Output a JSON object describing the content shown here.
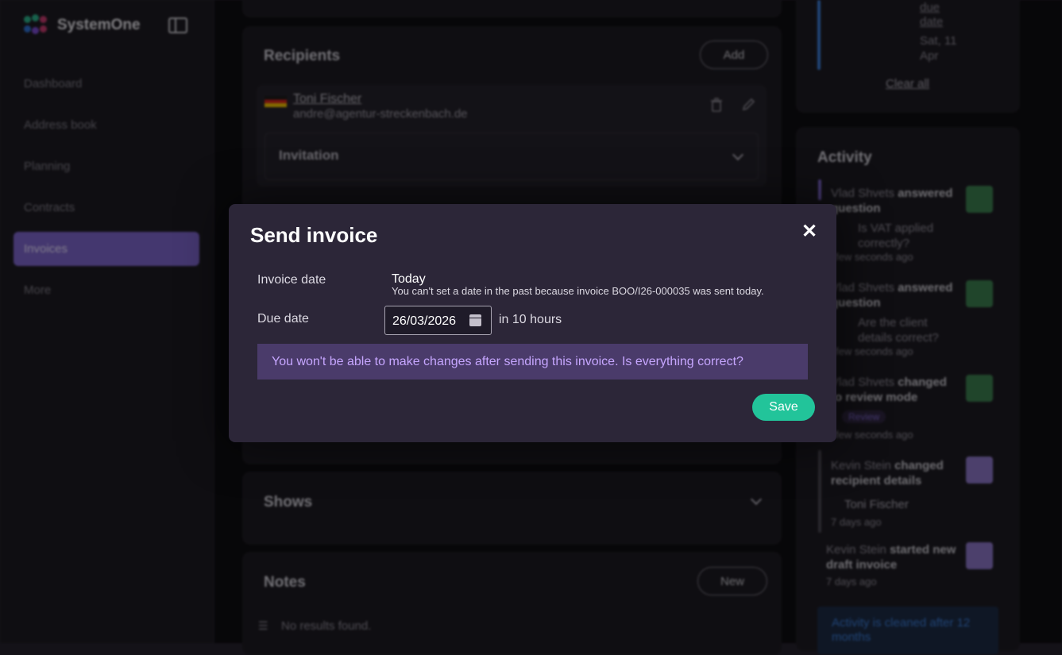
{
  "app": {
    "name": "SystemOne"
  },
  "sidebar": {
    "items": [
      {
        "label": "Dashboard"
      },
      {
        "label": "Address book"
      },
      {
        "label": "Planning"
      },
      {
        "label": "Contracts"
      },
      {
        "label": "Invoices"
      },
      {
        "label": "More"
      }
    ]
  },
  "recipients": {
    "title": "Recipients",
    "add_label": "Add",
    "recipient": {
      "name": "Toni Fischer",
      "email": "andre@agentur-streckenbach.de",
      "section": "Invitation"
    }
  },
  "shows": {
    "title": "Shows"
  },
  "notes": {
    "title": "Notes",
    "new_label": "New",
    "empty": "No results found."
  },
  "filter_panel": {
    "due_link": "due",
    "date_word": "date",
    "date_day": "Sat, 11",
    "date_month": "Apr",
    "clear_all": "Clear all"
  },
  "activity": {
    "title": "Activity",
    "items": [
      {
        "line1_name": "Vlad Shvets",
        "line1_action": "answered",
        "line2": "question",
        "detail1": "Is VAT applied",
        "detail2": "correctly?",
        "time": "few seconds ago"
      },
      {
        "line1_name": "Vlad Shvets",
        "line1_action": "answered",
        "line2": "question",
        "detail1": "Are the client",
        "detail2": "details correct?",
        "time": "few seconds ago"
      },
      {
        "line1_name": "Vlad Shvets",
        "line1_action": "changed",
        "line2": "to review mode",
        "badge": "Review",
        "time": "few seconds ago"
      },
      {
        "line1_name": "Kevin Stein",
        "line1_action": "changed",
        "line2": "recipient details",
        "detail1": "Toni Fischer",
        "time": "7 days ago"
      },
      {
        "line1_name": "Kevin Stein",
        "line1_action": "started new",
        "line2": "draft invoice",
        "time": "7 days ago"
      }
    ],
    "notice_line1": "Activity is cleaned after 12",
    "notice_line2": "months"
  },
  "modal": {
    "title": "Send invoice",
    "invoice_date_label": "Invoice date",
    "invoice_date_value": "Today",
    "invoice_date_warning": "You can't set a date in the past because invoice BOO/I26-000035 was sent today.",
    "due_date_label": "Due date",
    "due_date_value": "26/03/2026",
    "due_relative": "in 10 hours",
    "notice": "You won't be able to make changes after sending this invoice. Is everything correct?",
    "save_label": "Save",
    "close_symbol": "✕"
  },
  "colors": {
    "accent": "#7c64c9",
    "save": "#22c49a",
    "notice_bg": "#4a3b6a",
    "notice_text": "#c6a6ff"
  }
}
